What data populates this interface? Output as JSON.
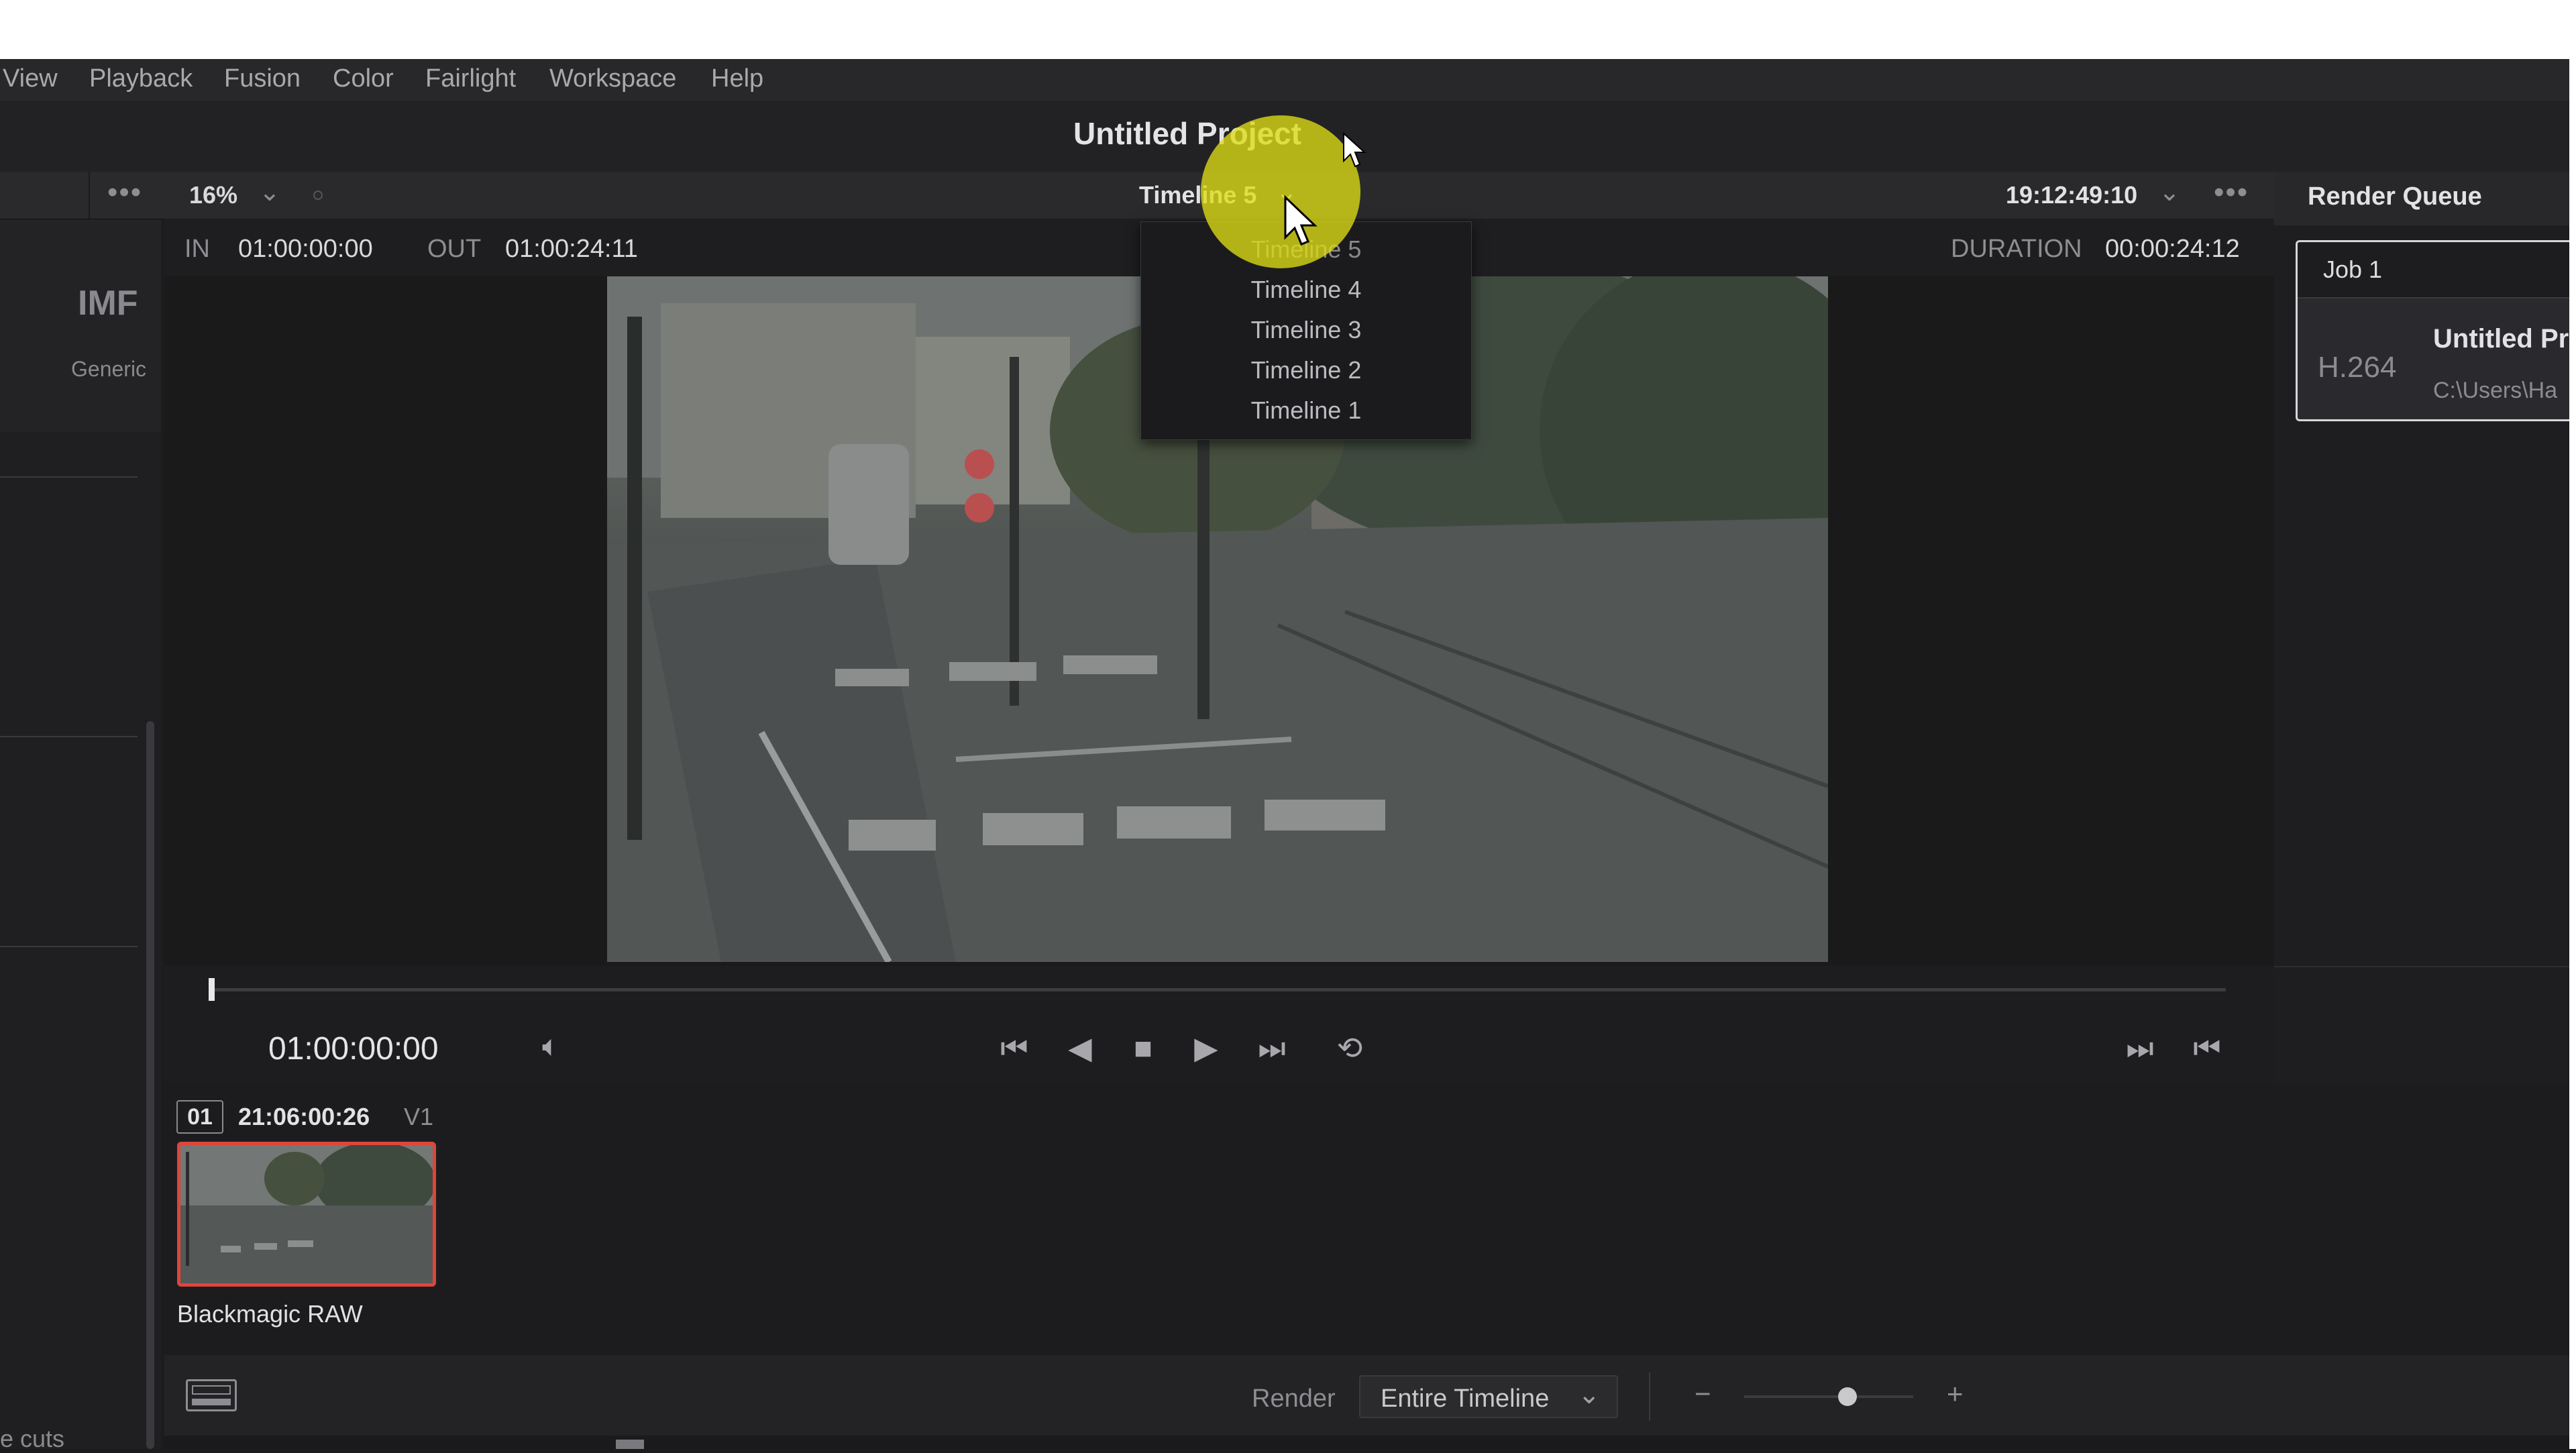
{
  "menu": [
    "View",
    "Playback",
    "Fusion",
    "Color",
    "Fairlight",
    "Workspace",
    "Help"
  ],
  "project_title": "Untitled Project",
  "viewer": {
    "zoom": "16%",
    "timeline_selected": "Timeline 5",
    "timecode_right": "19:12:49:10",
    "in_label": "IN",
    "in_value": "01:00:00:00",
    "out_label": "OUT",
    "out_value": "01:00:24:11",
    "duration_label": "DURATION",
    "duration_value": "00:00:24:12",
    "current_timecode": "01:00:00:00"
  },
  "timeline_dropdown": [
    "Timeline 5",
    "Timeline 4",
    "Timeline 3",
    "Timeline 2",
    "Timeline 1"
  ],
  "left_panel": {
    "title": "IMF",
    "subtitle": "Generic",
    "footer": "e cuts"
  },
  "render_queue": {
    "title": "Render Queue",
    "job_label": "Job 1",
    "codec": "H.264",
    "job_name": "Untitled Pr",
    "job_path": "C:\\Users\\Ha"
  },
  "clip": {
    "index": "01",
    "timecode": "21:06:00:26",
    "track": "V1",
    "name": "Blackmagic RAW"
  },
  "bottom": {
    "render_label": "Render",
    "render_option": "Entire Timeline",
    "zoom_minus": "−",
    "zoom_plus": "+"
  },
  "colors": {
    "accent_clip_border": "#e0453a",
    "cursor_highlight": "#dedc14"
  }
}
